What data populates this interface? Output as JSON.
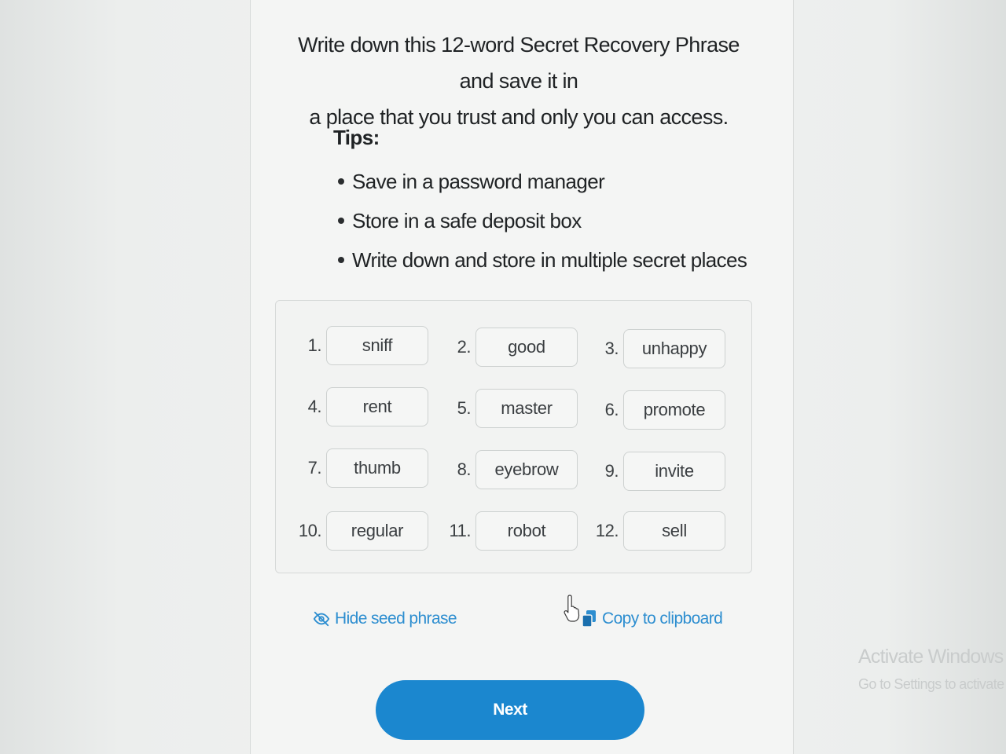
{
  "intro": {
    "line1": "Write down this 12-word Secret Recovery Phrase and save it in",
    "line2": "a place that you trust and only you can access."
  },
  "tips": {
    "title": "Tips:",
    "items": [
      "Save in a password manager",
      "Store in a safe deposit box",
      "Write down and store in multiple secret places"
    ]
  },
  "phrase": {
    "words": [
      {
        "index": "1.",
        "word": "sniff"
      },
      {
        "index": "2.",
        "word": "good"
      },
      {
        "index": "3.",
        "word": "unhappy"
      },
      {
        "index": "4.",
        "word": "rent"
      },
      {
        "index": "5.",
        "word": "master"
      },
      {
        "index": "6.",
        "word": "promote"
      },
      {
        "index": "7.",
        "word": "thumb"
      },
      {
        "index": "8.",
        "word": "eyebrow"
      },
      {
        "index": "9.",
        "word": "invite"
      },
      {
        "index": "10.",
        "word": "regular"
      },
      {
        "index": "11.",
        "word": "robot"
      },
      {
        "index": "12.",
        "word": "sell"
      }
    ]
  },
  "actions": {
    "hide_label": "Hide seed phrase",
    "copy_label": "Copy to clipboard",
    "next_label": "Next"
  },
  "watermark": {
    "title": "Activate Windows",
    "subtitle": "Go to Settings to activate W"
  },
  "colors": {
    "accent": "#1b87cf",
    "link": "#2d8ed0",
    "text": "#1f2224"
  }
}
